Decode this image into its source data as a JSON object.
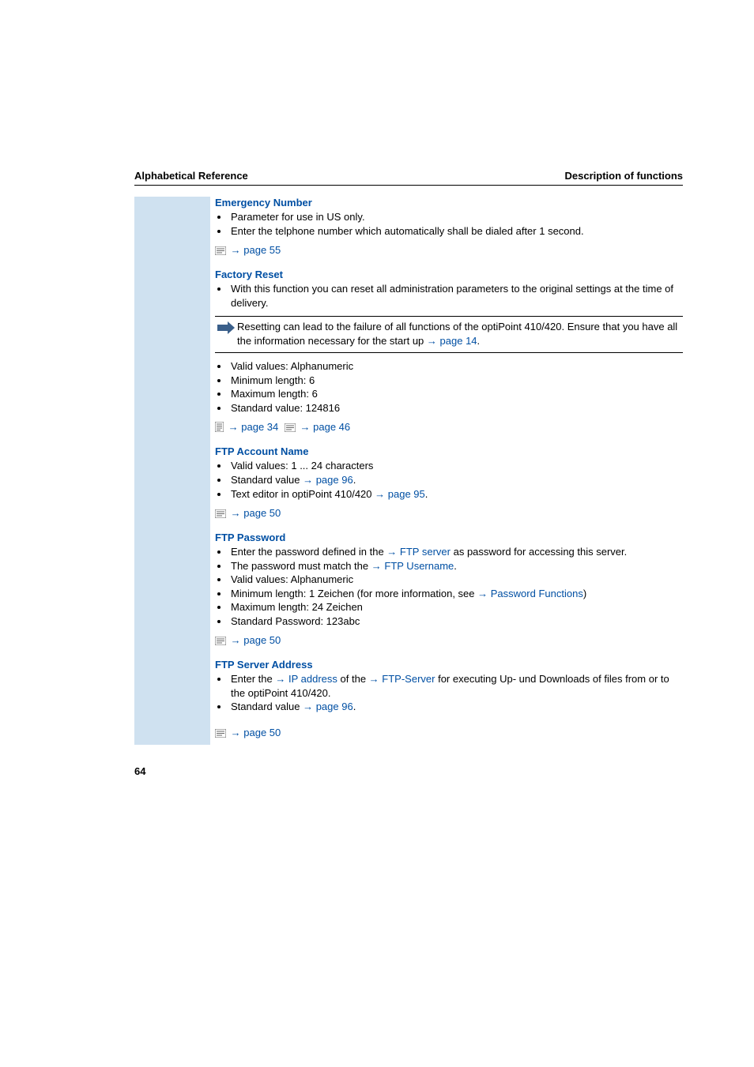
{
  "header": {
    "left": "Alphabetical Reference",
    "right": "Description of functions"
  },
  "emergency": {
    "title": "Emergency Number",
    "b1": "Parameter for use in US only.",
    "b2": "Enter the telphone number which automatically shall be dialed after 1 second.",
    "ref": "page 55"
  },
  "factory": {
    "title": "Factory Reset",
    "b1": "With this function you can reset all administration parameters to the original settings at the time of delivery.",
    "note_pre": "Resetting can lead to the failure of all functions of the optiPoint 410/420. Ensure that you have all the information necessary for the start up ",
    "note_link": "page 14",
    "note_post": ".",
    "b2": "Valid values: Alphanumeric",
    "b3": "Minimum length: 6",
    "b4": "Maximum length: 6",
    "b5": "Standard value: 124816",
    "refA": "page 34",
    "refB": "page 46"
  },
  "ftpacct": {
    "title": "FTP Account Name",
    "b1": "Valid values: 1 ... 24 characters",
    "b2_pre": "Standard value ",
    "b2_link": "page 96",
    "b2_post": ".",
    "b3_pre": "Text editor in optiPoint 410/420 ",
    "b3_link": "page 95",
    "b3_post": ".",
    "ref": "page 50"
  },
  "ftppw": {
    "title": "FTP Password",
    "b1_pre": "Enter the password defined in the ",
    "b1_link": "FTP server",
    "b1_post": " as password for accessing this server.",
    "b2_pre": "The password must match the ",
    "b2_link": "FTP Username",
    "b2_post": ".",
    "b3": "Valid values: Alphanumeric",
    "b4_pre": "Minimum length: 1 Zeichen (for more information, see ",
    "b4_link": "Password Functions",
    "b4_post": ")",
    "b5": "Maximum length: 24 Zeichen",
    "b6": "Standard Password: 123abc",
    "ref": "page 50"
  },
  "ftpsrv": {
    "title": "FTP Server Address",
    "b1_pre": "Enter the ",
    "b1_link1": "IP address",
    "b1_mid": " of the ",
    "b1_link2": "FTP-Server",
    "b1_post": " for executing Up- und Downloads of files from or to the optiPoint 410/420.",
    "b2_pre": "Standard value ",
    "b2_link": "page 96",
    "b2_post": ".",
    "ref": "page 50"
  },
  "pageNumber": "64",
  "arrow": "→"
}
